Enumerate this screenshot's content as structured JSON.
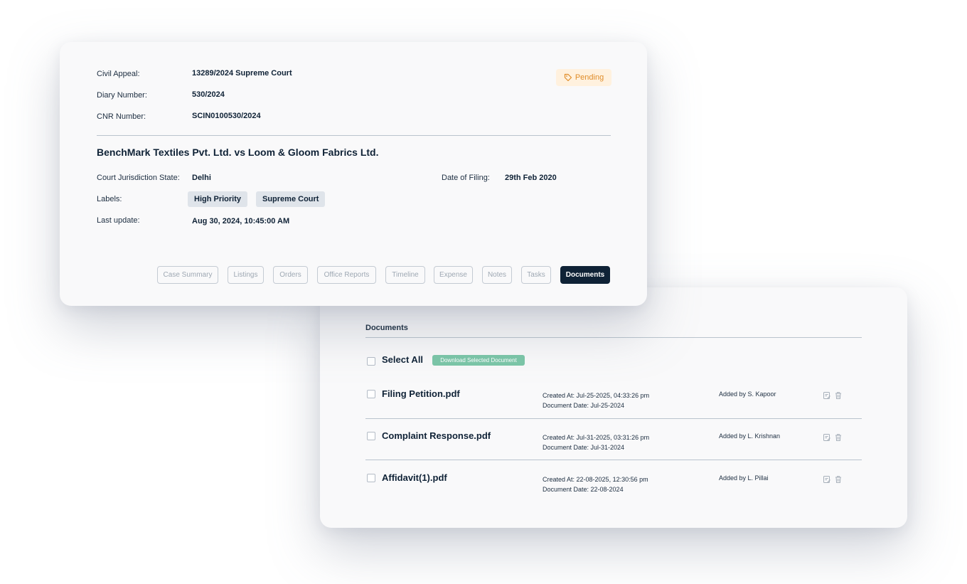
{
  "case": {
    "civil_appeal_label": "Civil Appeal:",
    "civil_appeal_value": "13289/2024 Supreme Court",
    "diary_label": "Diary Number:",
    "diary_value": "530/2024",
    "cnr_label": "CNR Number:",
    "cnr_value": "SCIN0100530/2024",
    "status": "Pending",
    "title": "BenchMark Textiles Pvt. Ltd. vs Loom & Gloom Fabrics Ltd.",
    "jurisdiction_label": "Court Jurisdiction State:",
    "jurisdiction_value": "Delhi",
    "filing_label": "Date of Filing:",
    "filing_value": "29th Feb 2020",
    "labels_label": "Labels:",
    "labels": [
      "High Priority",
      "Supreme Court"
    ],
    "last_update_label": "Last update:",
    "last_update_value": "Aug 30, 2024, 10:45:00 AM"
  },
  "tabs": [
    "Case Summary",
    "Listings",
    "Orders",
    "Office Reports",
    "Timeline",
    "Expense",
    "Notes",
    "Tasks",
    "Documents"
  ],
  "active_tab": "Documents",
  "documents": {
    "heading": "Documents",
    "select_all": "Select All",
    "download_button": "Download Selected Document",
    "rows": [
      {
        "name": "Filing Petition.pdf",
        "created": "Created At: Jul-25-2025, 04:33:26 pm",
        "doc_date": "Document Date: Jul-25-2024",
        "added_by": "Added by S. Kapoor"
      },
      {
        "name": "Complaint Response.pdf",
        "created": "Created At: Jul-31-2025, 03:31:26 pm",
        "doc_date": "Document Date: Jul-31-2024",
        "added_by": "Added by L. Krishnan"
      },
      {
        "name": "Affidavit(1).pdf",
        "created": "Created At: 22-08-2025, 12:30:56 pm",
        "doc_date": "Document Date: 22-08-2024",
        "added_by": "Added by L. Pillai"
      }
    ]
  },
  "colors": {
    "primary": "#0f2236",
    "pending_bg": "#fff1de",
    "pending_text": "#e08d2a",
    "download_button": "#7bc6a8",
    "chip_bg": "#dfe4ea"
  }
}
